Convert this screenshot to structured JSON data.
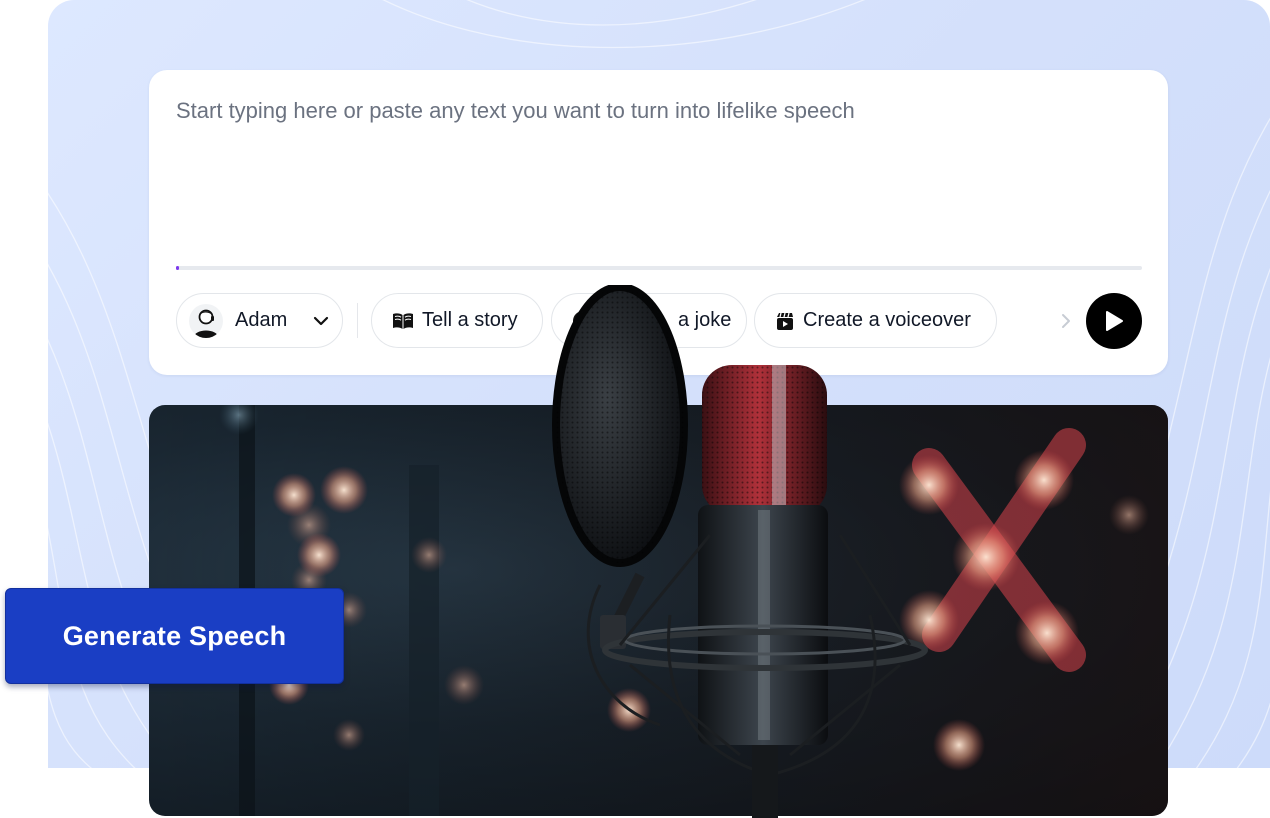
{
  "editor": {
    "placeholder": "Start typing here or paste any text you want to turn into lifelike speech",
    "value": "",
    "progress_fraction": 0.003
  },
  "voice_selector": {
    "name": "Adam",
    "icon": "person-avatar"
  },
  "suggestion_chips": [
    {
      "label": "Tell a story",
      "icon": "open-book-icon"
    },
    {
      "label": "a joke",
      "icon": "smile-icon"
    },
    {
      "label": "Create a voiceover",
      "icon": "clapperboard-icon"
    }
  ],
  "actions": {
    "more_icon": "chevron-right-icon",
    "play_icon": "play-icon",
    "generate_label": "Generate Speech"
  },
  "colors": {
    "accent": "#1a3ec4",
    "background": "#d4e0fb",
    "progress": "#7c3aed",
    "play_button": "#000000"
  }
}
